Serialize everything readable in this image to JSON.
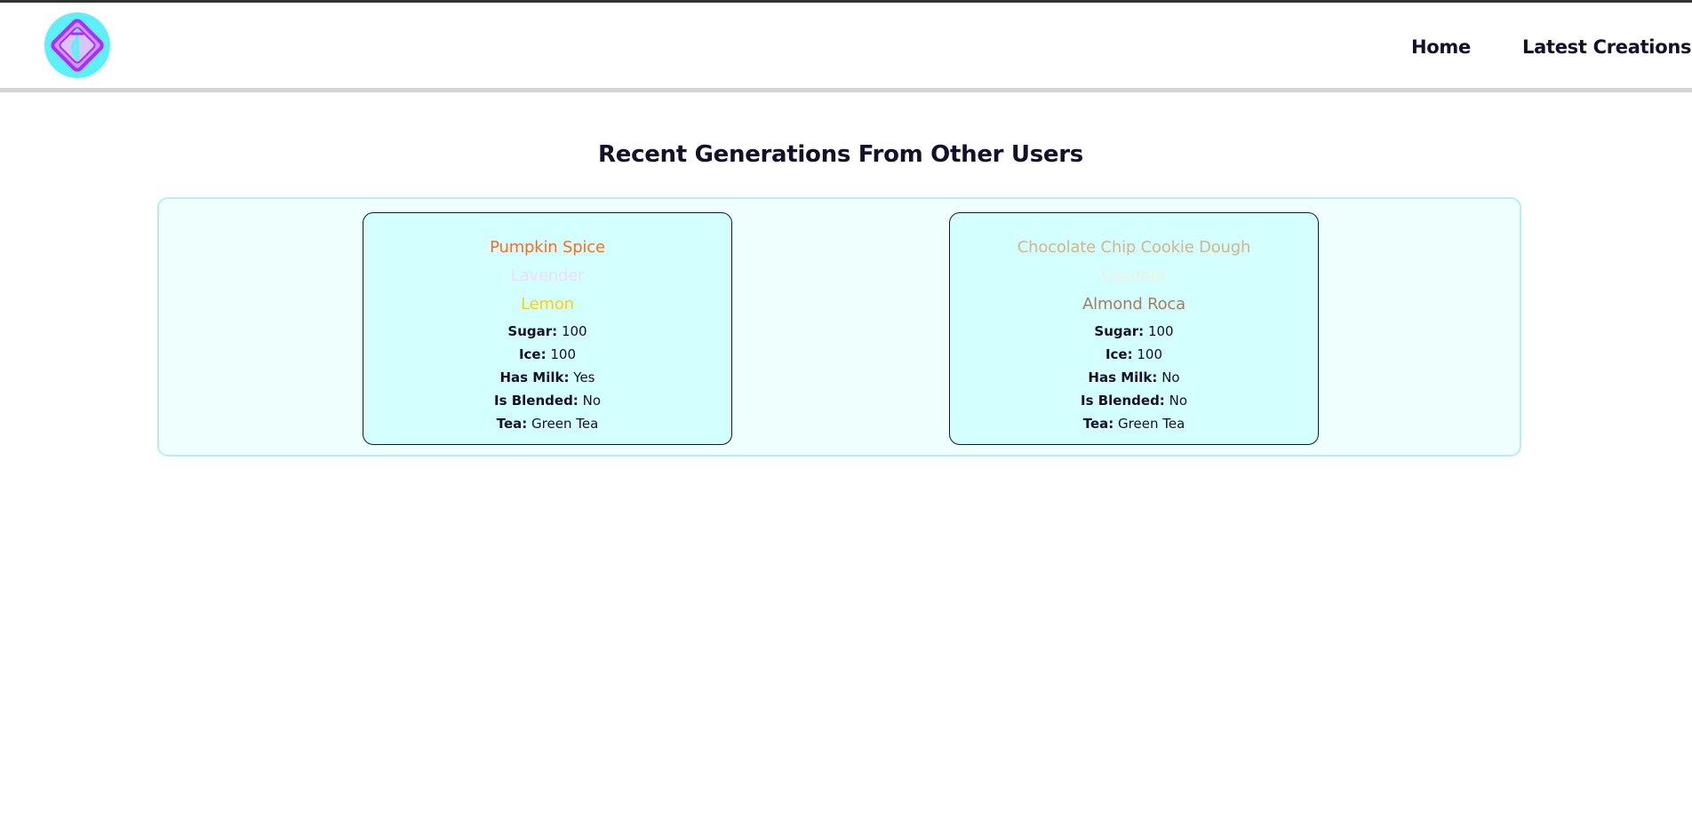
{
  "nav": {
    "home": "Home",
    "latest": "Latest Creations"
  },
  "page": {
    "title": "Recent Generations From Other Users"
  },
  "labels": {
    "sugar": "Sugar:",
    "ice": "Ice:",
    "has_milk": "Has Milk:",
    "is_blended": "Is Blended:",
    "tea": "Tea:"
  },
  "cards": [
    {
      "flavors": [
        {
          "name": "Pumpkin Spice",
          "color": "#ff6b1a"
        },
        {
          "name": "Lavender",
          "color": "#f0dcf8"
        },
        {
          "name": "Lemon",
          "color": "#ffd200"
        }
      ],
      "sugar": "100",
      "ice": "100",
      "has_milk": "Yes",
      "is_blended": "No",
      "tea": "Green Tea"
    },
    {
      "flavors": [
        {
          "name": "Chocolate Chip Cookie Dough",
          "color": "#d3b587"
        },
        {
          "name": "Coconut",
          "color": "#f2f0dc"
        },
        {
          "name": "Almond Roca",
          "color": "#a87c5c"
        }
      ],
      "sugar": "100",
      "ice": "100",
      "has_milk": "No",
      "is_blended": "No",
      "tea": "Green Tea"
    }
  ],
  "colors": {
    "panel_bg": "#effffe",
    "panel_border": "#b9eef0",
    "card_bg": "#d4ffff",
    "text": "#14102a",
    "logo_outer": "#5ef0f8",
    "logo_accent": "#b428ff"
  },
  "icons": {
    "logo": "tea-logo-icon"
  }
}
